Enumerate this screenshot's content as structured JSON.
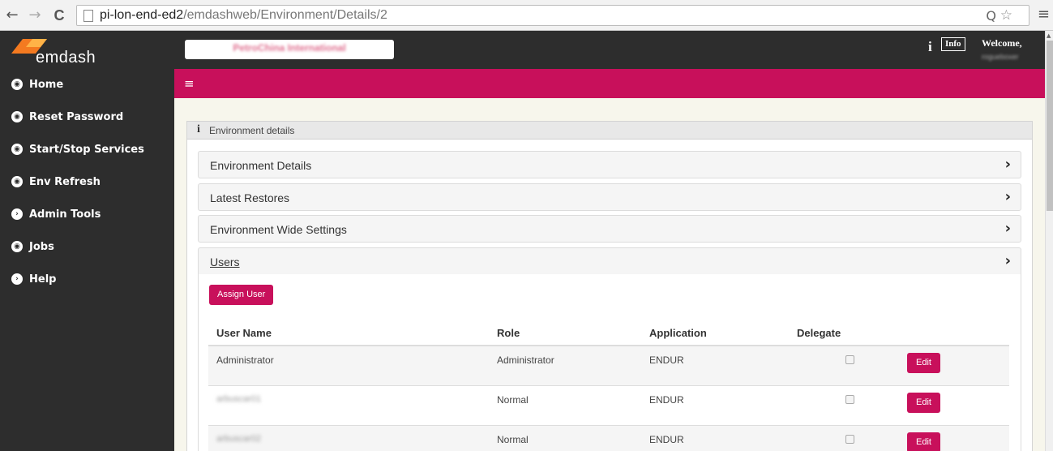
{
  "browser": {
    "url_host": "pi-lon-end-ed2",
    "url_path": "/emdashweb/Environment/Details/2",
    "back_glyph": "←",
    "forward_glyph": "→",
    "reload_glyph": "C",
    "zoom_glyph": "Q",
    "star_glyph": "☆",
    "menu_glyph": "≡"
  },
  "logo": {
    "text": "emdash"
  },
  "sidebar": {
    "items": [
      {
        "label": "Home",
        "icon": "dashboard-icon",
        "glyph": "◉"
      },
      {
        "label": "Reset Password",
        "icon": "dashboard-icon",
        "glyph": "◉"
      },
      {
        "label": "Start/Stop Services",
        "icon": "dashboard-icon",
        "glyph": "◉"
      },
      {
        "label": "Env Refresh",
        "icon": "dashboard-icon",
        "glyph": "◉"
      },
      {
        "label": "Admin Tools",
        "icon": "arrow-circle-right-icon",
        "glyph": "›"
      },
      {
        "label": "Jobs",
        "icon": "dashboard-icon",
        "glyph": "◉"
      },
      {
        "label": "Help",
        "icon": "arrow-circle-right-icon",
        "glyph": "›"
      }
    ]
  },
  "topbar": {
    "company": "PetroChina International",
    "info_glyph": "i",
    "info_label": "Info",
    "welcome": "Welcome,",
    "username": "rogueboxer"
  },
  "pinkbar": {
    "hamburger_glyph": "≡"
  },
  "panel": {
    "title": "Environment details",
    "icon_glyph": "i",
    "sections": [
      {
        "title": "Environment Details"
      },
      {
        "title": "Latest Restores"
      },
      {
        "title": "Environment Wide Settings"
      },
      {
        "title": "Users"
      }
    ],
    "chevron": "›"
  },
  "users": {
    "assign_label": "Assign User",
    "columns": [
      "User Name",
      "Role",
      "Application",
      "Delegate"
    ],
    "edit_label": "Edit",
    "rows": [
      {
        "user": "Administrator",
        "role": "Administrator",
        "application": "ENDUR"
      },
      {
        "user": "arbuscar01",
        "role": "Normal",
        "application": "ENDUR"
      },
      {
        "user": "arbuscar02",
        "role": "Normal",
        "application": "ENDUR"
      }
    ]
  },
  "colors": {
    "accent": "#c8105b",
    "sidebar": "#2d2d2d",
    "logo_orange": "#f47a20"
  }
}
